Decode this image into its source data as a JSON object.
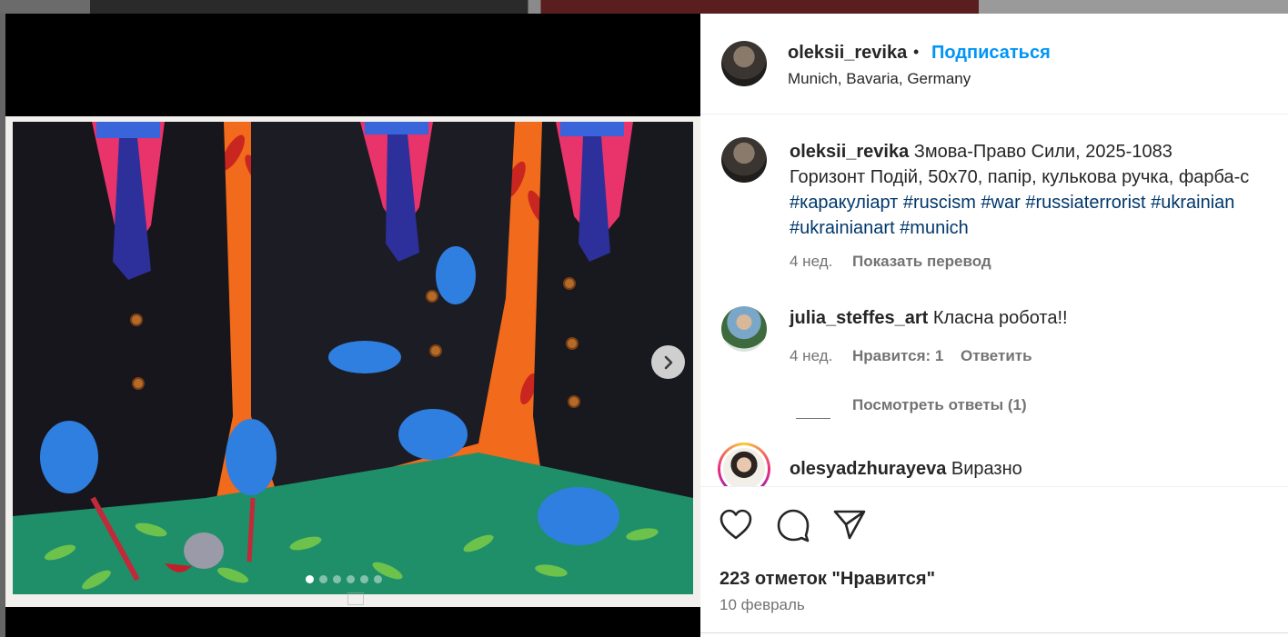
{
  "post": {
    "username": "oleksii_revika",
    "follow_label": "Подписаться",
    "bullet": "•",
    "location": "Munich, Bavaria, Germany"
  },
  "caption": {
    "username": "oleksii_revika",
    "line1": "Змова-Право Сили, 2025-1083",
    "line2": "Горизонт Подій, 50х70, папір, кулькова ручка, фарба-с",
    "hashtags_line1": "#каракуліарт #ruscism #war #russiaterrorist #ukrainian",
    "hashtags_line2": "#ukrainianart #munich",
    "time": "4 нед.",
    "translate_label": "Показать перевод"
  },
  "comments": [
    {
      "username": "julia_steffes_art",
      "text": "Класна робота!!",
      "time": "4 нед.",
      "likes_label": "Нравится: 1",
      "reply_label": "Ответить",
      "view_replies_label": "Посмотреть ответы (1)"
    },
    {
      "username": "olesyadzhurayeva",
      "text": "Виразно"
    }
  ],
  "actions": {
    "like_icon": "heart-icon",
    "comment_icon": "comment-icon",
    "share_icon": "paper-plane-icon"
  },
  "likes_text": "223 отметок \"Нравится\"",
  "date": "10 февраль",
  "carousel": {
    "total_slides": 6,
    "active_index": 0,
    "next_icon": "chevron-right-icon"
  },
  "colors": {
    "link_blue": "#0095f6",
    "hashtag_blue": "#00376b",
    "secondary_text": "#737373"
  }
}
